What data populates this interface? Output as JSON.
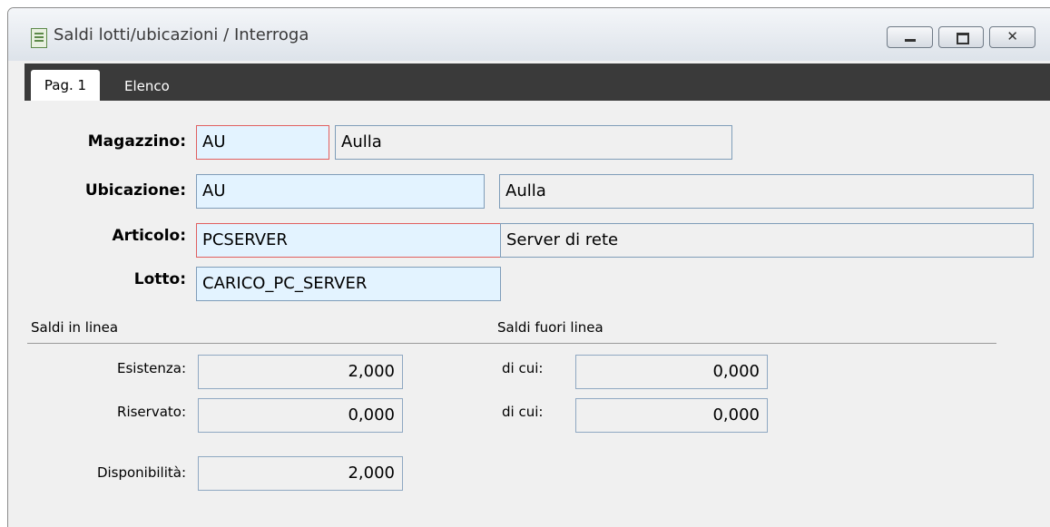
{
  "window": {
    "title": "Saldi lotti/ubicazioni / Interroga",
    "icon": "form-icon",
    "controls": {
      "minimize": "minimize-icon",
      "maximize": "maximize-icon",
      "close": "✕"
    }
  },
  "tabs": [
    {
      "label": "Pag. 1",
      "active": true
    },
    {
      "label": "Elenco",
      "active": false
    }
  ],
  "form": {
    "magazzino": {
      "label": "Magazzino:",
      "code": "AU",
      "desc": "Aulla"
    },
    "ubicazione": {
      "label": "Ubicazione:",
      "code": "AU",
      "desc": "Aulla"
    },
    "articolo": {
      "label": "Articolo:",
      "code": "PCSERVER",
      "desc": "Server di rete"
    },
    "lotto": {
      "label": "Lotto:",
      "code": "CARICO_PC_SERVER"
    }
  },
  "saldi_in_linea": {
    "title": "Saldi in linea",
    "esistenza": {
      "label": "Esistenza:",
      "value": "2,000"
    },
    "riservato": {
      "label": "Riservato:",
      "value": "0,000"
    },
    "disponibilita": {
      "label": "Disponibilità:",
      "value": "2,000"
    }
  },
  "saldi_fuori_linea": {
    "title": "Saldi fuori linea",
    "di_cui_1": {
      "label": "di cui:",
      "value": "0,000"
    },
    "di_cui_2": {
      "label": "di cui:",
      "value": "0,000"
    }
  },
  "colors": {
    "code_field_bg": "#e3f3ff",
    "required_border": "#e06060",
    "tabbar_bg": "#3a3a3a"
  }
}
